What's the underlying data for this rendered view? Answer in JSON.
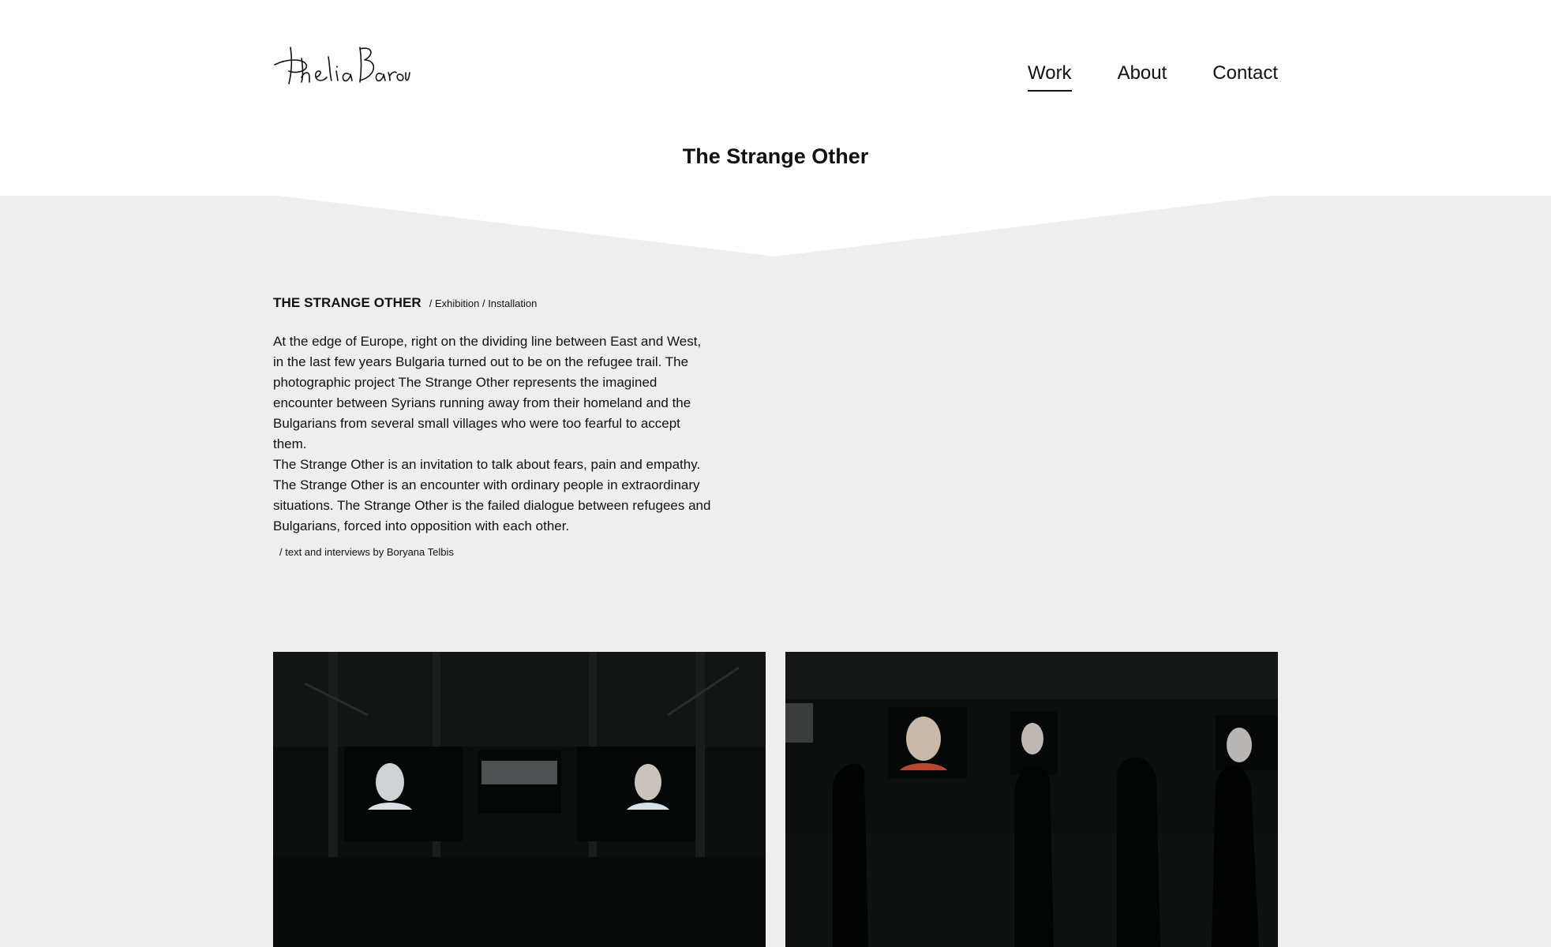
{
  "site": {
    "logo_text": "Phelia Barouh",
    "nav": [
      {
        "label": "Work",
        "active": true
      },
      {
        "label": "About",
        "active": false
      },
      {
        "label": "Contact",
        "active": false
      }
    ]
  },
  "page": {
    "title": "The Strange Other"
  },
  "project": {
    "name": "THE STRANGE OTHER",
    "tags": "/ Exhibition / Installation",
    "paragraphs": [
      "At the edge of Europe, right on the dividing line between East and West, in the last few years Bulgaria turned out to be on the refugee trail. The photographic project The Strange Other represents the imagined encounter between Syrians running away from their homeland and the Bulgarians from several small villages who were too fearful to accept them.",
      "The Strange Other is an invitation to talk about fears, pain and empathy. The Strange Other is an encounter with ordinary people in extraordinary situations. The Strange Other is the failed dialogue between refugees and Bulgarians, forced into opposition with each other."
    ],
    "credit": "/ text and interviews by Boryana Telbis"
  },
  "gallery": [
    {
      "name": "installation-view-screens"
    },
    {
      "name": "installation-view-visitors"
    }
  ],
  "colors": {
    "background": "#eeeeee",
    "header": "#ffffff",
    "text": "#111111"
  }
}
